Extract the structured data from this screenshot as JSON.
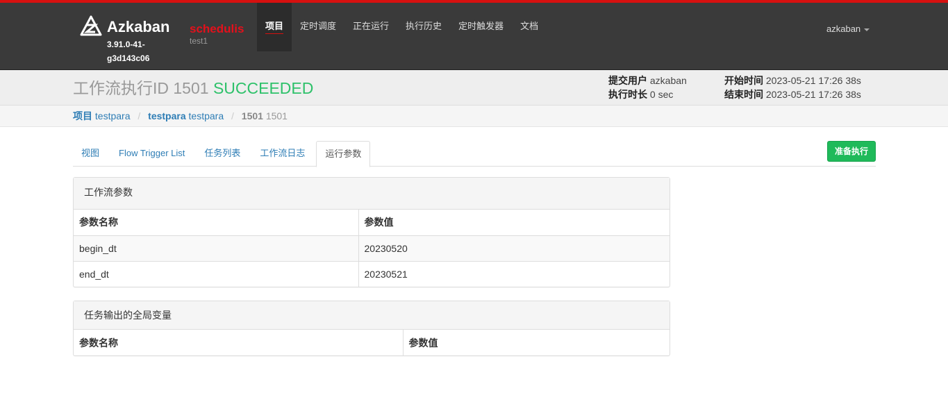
{
  "topbar": {
    "brand_name": "Azkaban",
    "brand_version": "3.91.0-41-g3d143c06",
    "scheduler_name": "schedulis",
    "scheduler_env": "test1",
    "nav": [
      "项目",
      "定时调度",
      "正在运行",
      "执行历史",
      "定时触发器",
      "文档"
    ],
    "active_nav": "项目",
    "user": "azkaban",
    "accent_color": "#d6100f"
  },
  "header": {
    "title_prefix": "工作流执行ID 1501",
    "status": "SUCCEEDED",
    "submit_user_label": "提交用户",
    "submit_user": "azkaban",
    "duration_label": "执行时长",
    "duration": "0 sec",
    "start_label": "开始时间",
    "start_time": "2023-05-21 17:26 38s",
    "end_label": "结束时间",
    "end_time": "2023-05-21 17:26 38s",
    "status_color": "#2ec16a"
  },
  "breadcrumb": {
    "project_label": "项目",
    "project_value": "testpara",
    "flow_label": "testpara",
    "flow_value": "testpara",
    "exec_label": "1501",
    "exec_value": "1501"
  },
  "tabs": [
    "视图",
    "Flow Trigger List",
    "任务列表",
    "工作流日志",
    "运行参数"
  ],
  "active_tab": "运行参数",
  "run_button": "准备执行",
  "flow_params_panel": {
    "title": "工作流参数",
    "columns": [
      "参数名称",
      "参数值"
    ],
    "rows": [
      [
        "begin_dt",
        "20230520"
      ],
      [
        "end_dt",
        "20230521"
      ]
    ]
  },
  "global_vars_panel": {
    "title": "任务输出的全局变量",
    "columns": [
      "参数名称",
      "参数值"
    ],
    "rows": []
  }
}
